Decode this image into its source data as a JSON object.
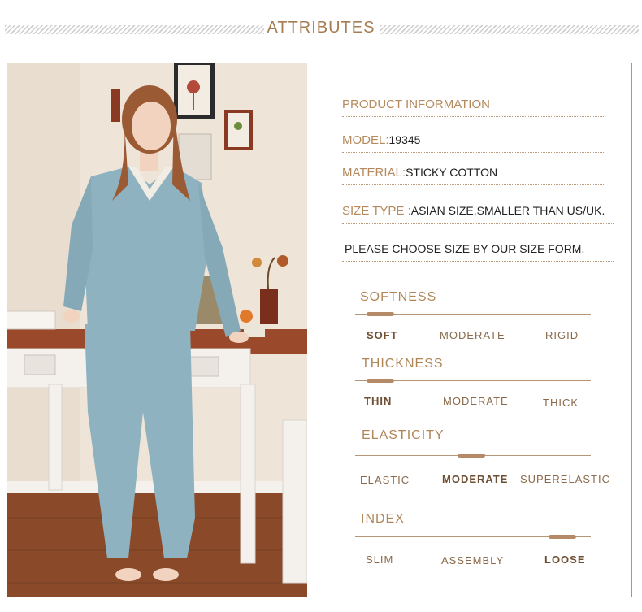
{
  "header": {
    "title": "ATTRIBUTES"
  },
  "product": {
    "heading": "PRODUCT INFORMATION",
    "model_label": "MODEL:",
    "model_value": "19345",
    "material_label": "MATERIAL:",
    "material_value": "STICKY COTTON",
    "size_label": "SIZE TYPE :",
    "size_value": "ASIAN SIZE,SMALLER THAN US/UK.",
    "note": "PLEASE CHOOSE SIZE BY OUR SIZE FORM."
  },
  "attributes": {
    "softness": {
      "title": "SOFTNESS",
      "options": [
        "SOFT",
        "MODERATE",
        "RIGID"
      ],
      "selected": "SOFT"
    },
    "thickness": {
      "title": "THICKNESS",
      "options": [
        "THIN",
        "MODERATE",
        "THICK"
      ],
      "selected": "THIN"
    },
    "elasticity": {
      "title": "ELASTICITY",
      "options": [
        "ELASTIC",
        "MODERATE",
        "SUPERELASTIC"
      ],
      "selected": "MODERATE"
    },
    "index": {
      "title": "INDEX",
      "options": [
        "SLIM",
        "ASSEMBLY",
        "LOOSE"
      ],
      "selected": "LOOSE"
    }
  },
  "colors": {
    "accent": "#b08658",
    "pajama": "#8fb2c0",
    "wall": "#efe4d8"
  }
}
